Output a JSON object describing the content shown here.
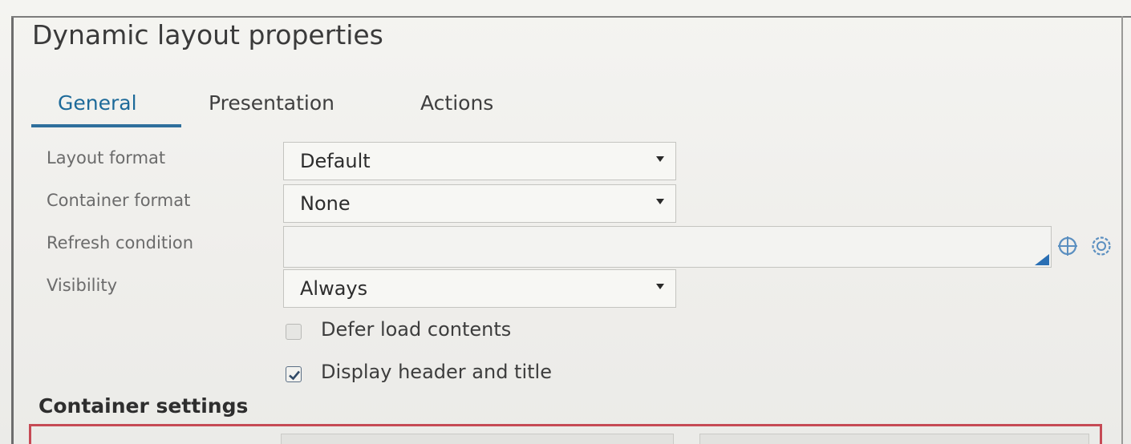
{
  "dialog": {
    "title": "Dynamic layout properties"
  },
  "tabs": [
    {
      "label": "General",
      "active": true
    },
    {
      "label": "Presentation",
      "active": false
    },
    {
      "label": "Actions",
      "active": false
    }
  ],
  "form": {
    "layout_format": {
      "label": "Layout format",
      "value": "Default"
    },
    "container_format": {
      "label": "Container format",
      "value": "None"
    },
    "refresh_condition": {
      "label": "Refresh condition",
      "value": ""
    },
    "visibility": {
      "label": "Visibility",
      "value": "Always"
    },
    "defer_load": {
      "label": "Defer load contents",
      "checked": false
    },
    "display_header": {
      "label": "Display header and title",
      "checked": true
    }
  },
  "sections": {
    "container_settings": "Container settings"
  },
  "colors": {
    "accent": "#1d6a99",
    "tab_underline": "#2f6f9c",
    "highlight_border": "#c64a55"
  },
  "icons": {
    "condition_builder": "crosshair-icon",
    "condition_settings": "gear-icon",
    "dropdown": "chevron-down-icon",
    "check": "check-icon"
  }
}
